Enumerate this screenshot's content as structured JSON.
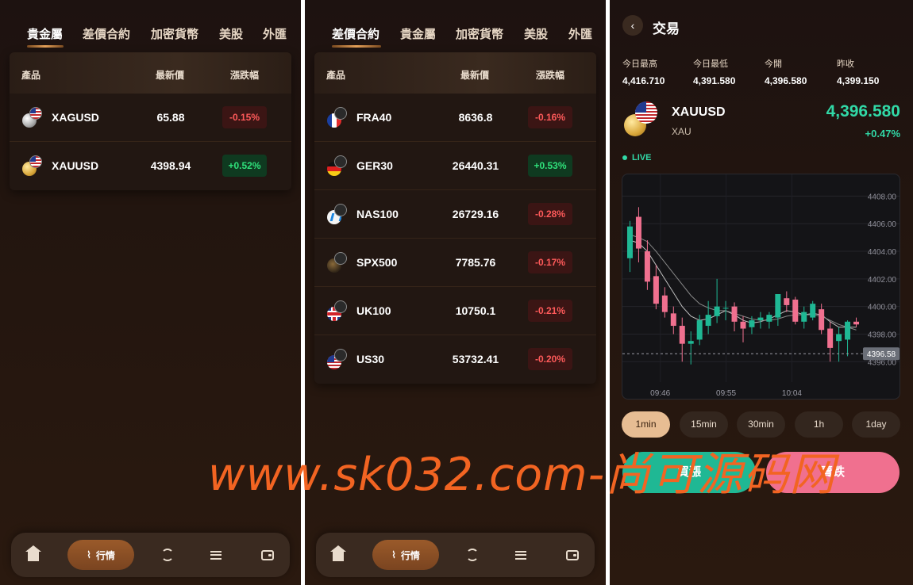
{
  "panels": [
    {
      "tabs": [
        "貴金屬",
        "差價合約",
        "加密貨幣",
        "美股",
        "外匯"
      ],
      "headers": {
        "product": "產品",
        "price": "最新價",
        "change": "漲跌幅"
      },
      "rows": [
        {
          "symbol": "XAGUSD",
          "price": "65.88",
          "change": "-0.15%",
          "dir": "down",
          "icon": "silver-coin-icon"
        },
        {
          "symbol": "XAUUSD",
          "price": "4398.94",
          "change": "+0.52%",
          "dir": "up",
          "icon": "gold-coin-icon"
        }
      ],
      "nav_label": "行情"
    },
    {
      "tabs": [
        "差價合約",
        "貴金屬",
        "加密貨幣",
        "美股",
        "外匯"
      ],
      "headers": {
        "product": "產品",
        "price": "最新價",
        "change": "漲跌幅"
      },
      "rows": [
        {
          "symbol": "FRA40",
          "price": "8636.8",
          "change": "-0.16%",
          "dir": "down",
          "icon": "france-flag-icon"
        },
        {
          "symbol": "GER30",
          "price": "26440.31",
          "change": "+0.53%",
          "dir": "up",
          "icon": "germany-flag-icon"
        },
        {
          "symbol": "NAS100",
          "price": "26729.16",
          "change": "-0.28%",
          "dir": "down",
          "icon": "nasdaq-icon"
        },
        {
          "symbol": "SPX500",
          "price": "7785.76",
          "change": "-0.17%",
          "dir": "down",
          "icon": "spx-icon"
        },
        {
          "symbol": "UK100",
          "price": "10750.1",
          "change": "-0.21%",
          "dir": "down",
          "icon": "uk-flag-icon"
        },
        {
          "symbol": "US30",
          "price": "53732.41",
          "change": "-0.20%",
          "dir": "down",
          "icon": "us-flag-icon"
        }
      ],
      "nav_label": "行情"
    }
  ],
  "trade": {
    "title": "交易",
    "stats": [
      {
        "label": "今日最高",
        "value": "4,416.710"
      },
      {
        "label": "今日最低",
        "value": "4,391.580"
      },
      {
        "label": "今開",
        "value": "4,396.580"
      },
      {
        "label": "昨收",
        "value": "4,399.150"
      }
    ],
    "symbol": "XAUUSD",
    "sub": "XAU",
    "price": "4,396.580",
    "change": "+0.47%",
    "live": "LIVE",
    "timeframes": [
      "1min",
      "15min",
      "30min",
      "1h",
      "1day"
    ],
    "active_timeframe": "1min",
    "buy_label": "買漲",
    "sell_label": "賣跌",
    "colors": {
      "up": "#1fb894",
      "down": "#f0708f",
      "accent": "#31d9a7"
    }
  },
  "chart_data": {
    "type": "candlestick",
    "y_ticks": [
      "4408.00",
      "4406.00",
      "4404.00",
      "4402.00",
      "4400.00",
      "4398.00",
      "4396.00"
    ],
    "x_ticks": [
      "09:46",
      "09:55",
      "10:04"
    ],
    "ylim": [
      4395.5,
      4409.0
    ],
    "current_price_label": "4396.58",
    "current_price": 4396.58,
    "candles": [
      {
        "o": 4403.5,
        "h": 4406.2,
        "l": 4402.5,
        "c": 4405.8
      },
      {
        "o": 4406.5,
        "h": 4407.2,
        "l": 4403.2,
        "c": 4404.2
      },
      {
        "o": 4404.0,
        "h": 4404.8,
        "l": 4401.2,
        "c": 4401.8
      },
      {
        "o": 4402.2,
        "h": 4403.0,
        "l": 4399.8,
        "c": 4400.2
      },
      {
        "o": 4400.8,
        "h": 4401.4,
        "l": 4399.2,
        "c": 4399.6
      },
      {
        "o": 4399.5,
        "h": 4400.0,
        "l": 4398.0,
        "c": 4398.6
      },
      {
        "o": 4398.6,
        "h": 4399.2,
        "l": 4396.0,
        "c": 4397.3
      },
      {
        "o": 4397.3,
        "h": 4398.2,
        "l": 4395.8,
        "c": 4397.5
      },
      {
        "o": 4397.6,
        "h": 4399.4,
        "l": 4397.2,
        "c": 4399.0
      },
      {
        "o": 4398.6,
        "h": 4400.4,
        "l": 4398.0,
        "c": 4399.4
      },
      {
        "o": 4399.3,
        "h": 4402.0,
        "l": 4398.8,
        "c": 4400.0
      },
      {
        "o": 4399.9,
        "h": 4400.4,
        "l": 4399.0,
        "c": 4399.9
      },
      {
        "o": 4400.0,
        "h": 4400.3,
        "l": 4398.2,
        "c": 4398.9
      },
      {
        "o": 4398.9,
        "h": 4399.3,
        "l": 4397.4,
        "c": 4398.4
      },
      {
        "o": 4398.5,
        "h": 4399.3,
        "l": 4398.0,
        "c": 4399.0
      },
      {
        "o": 4399.0,
        "h": 4399.6,
        "l": 4398.4,
        "c": 4399.2
      },
      {
        "o": 4398.9,
        "h": 4399.6,
        "l": 4398.4,
        "c": 4399.4
      },
      {
        "o": 4399.2,
        "h": 4400.6,
        "l": 4398.6,
        "c": 4400.9
      },
      {
        "o": 4400.6,
        "h": 4401.1,
        "l": 4399.6,
        "c": 4400.1
      },
      {
        "o": 4400.5,
        "h": 4400.7,
        "l": 4398.7,
        "c": 4398.9
      },
      {
        "o": 4398.9,
        "h": 4400.0,
        "l": 4398.4,
        "c": 4399.6
      },
      {
        "o": 4399.2,
        "h": 4400.4,
        "l": 4399.0,
        "c": 4400.2
      },
      {
        "o": 4399.8,
        "h": 4400.2,
        "l": 4398.0,
        "c": 4398.3
      },
      {
        "o": 4398.4,
        "h": 4398.9,
        "l": 4396.0,
        "c": 4397.0
      },
      {
        "o": 4397.5,
        "h": 4398.5,
        "l": 4396.0,
        "c": 4398.0
      },
      {
        "o": 4397.6,
        "h": 4399.0,
        "l": 4396.4,
        "c": 4398.9
      },
      {
        "o": 4398.9,
        "h": 4399.2,
        "l": 4398.5,
        "c": 4398.7
      }
    ],
    "ma_lines": [
      {
        "color": "#bfbfbf",
        "values": [
          4404.8,
          4404.6,
          4404.0,
          4403.0,
          4402.0,
          4401.0,
          4400.0,
          4399.3,
          4399.0,
          4399.1,
          4399.4,
          4399.7,
          4399.4,
          4399.0,
          4398.8,
          4398.9,
          4399.1,
          4399.4,
          4399.7,
          4399.6,
          4399.4,
          4399.5,
          4399.4,
          4398.9,
          4398.5,
          4398.5,
          4398.5
        ]
      },
      {
        "color": "#888888",
        "values": [
          4405.2,
          4405.0,
          4404.7,
          4404.0,
          4403.2,
          4402.4,
          4401.6,
          4400.8,
          4400.2,
          4399.9,
          4399.7,
          4399.7,
          4399.5,
          4399.3,
          4399.1,
          4399.0,
          4399.0,
          4399.1,
          4399.3,
          4399.4,
          4399.4,
          4399.4,
          4399.3,
          4399.0,
          4398.7,
          4398.5,
          4398.3
        ]
      }
    ]
  },
  "watermark": "www.sk032.com-尚可源码网"
}
